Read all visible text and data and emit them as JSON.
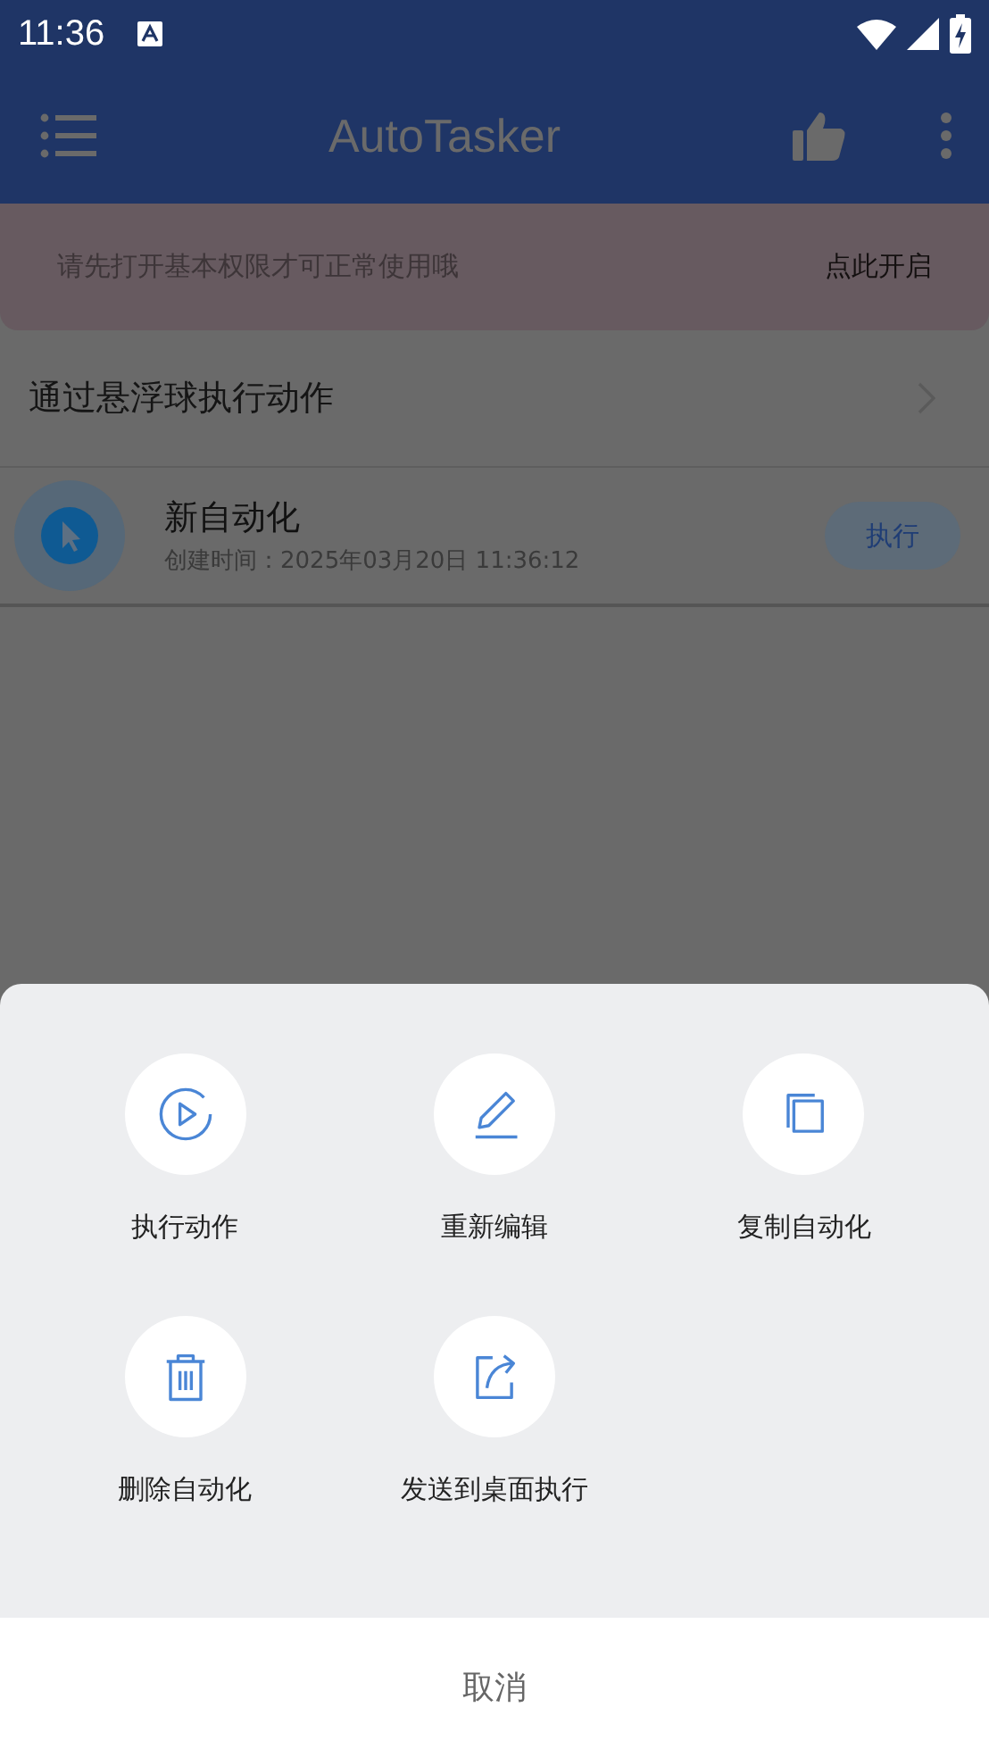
{
  "status_bar": {
    "time": "11:36"
  },
  "app_bar": {
    "title": "AutoTasker"
  },
  "permission_banner": {
    "message": "请先打开基本权限才可正常使用哦",
    "action": "点此开启"
  },
  "floating_ball_row": {
    "label": "通过悬浮球执行动作"
  },
  "automations": [
    {
      "name": "新自动化",
      "created": "创建时间：2025年03月20日 11:36:12",
      "run_button": "执行"
    }
  ],
  "action_sheet": {
    "actions": [
      {
        "kind": "run",
        "label": "执行动作"
      },
      {
        "kind": "edit",
        "label": "重新编辑"
      },
      {
        "kind": "copy",
        "label": "复制自动化"
      },
      {
        "kind": "delete",
        "label": "删除自动化"
      },
      {
        "kind": "send",
        "label": "发送到桌面执行"
      }
    ],
    "cancel": "取消"
  }
}
